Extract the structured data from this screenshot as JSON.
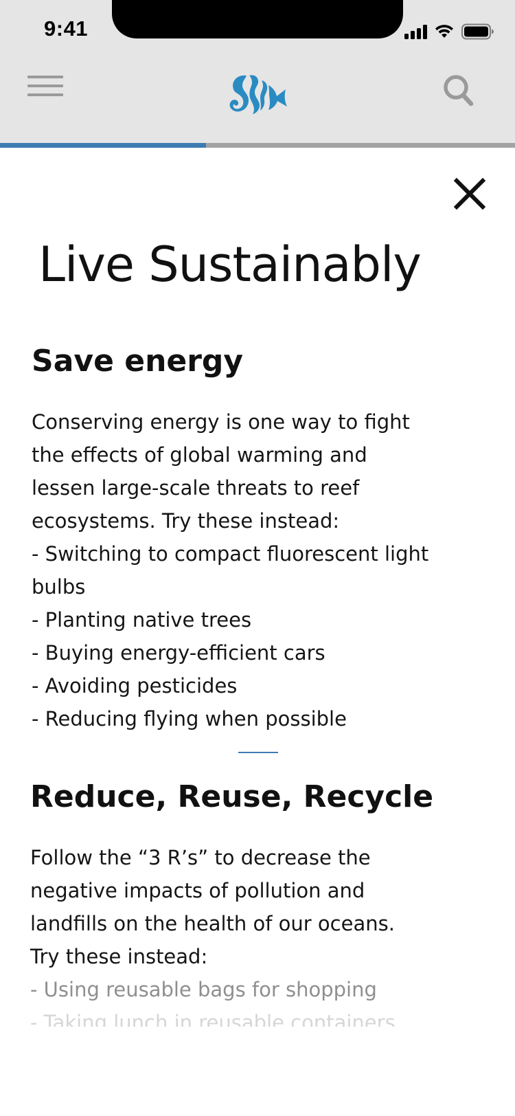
{
  "status_bar": {
    "time": "9:41"
  },
  "header": {
    "progress_fraction": 0.4,
    "accent_color": "#3f7bb3",
    "logo_color": "#2a8bc2"
  },
  "page": {
    "title": "Live Sustainably"
  },
  "sections": [
    {
      "heading": "Save energy",
      "lines": [
        "Conserving energy is one way to fight",
        "the effects of global warming and",
        "lessen large-scale threats to reef",
        "ecosystems. Try these instead:",
        "- Switching to compact fluorescent light",
        "bulbs",
        "- Planting native trees",
        "- Buying energy-efficient cars",
        "- Avoiding pesticides",
        "- Reducing flying when possible"
      ]
    },
    {
      "heading": "Reduce, Reuse, Recycle",
      "lines": [
        "Follow the “3 R’s” to decrease the",
        "negative impacts of pollution and",
        "landfills on the health of our oceans.",
        "Try these instead:",
        "- Using reusable bags for shopping",
        "- Taking lunch in reusable containers"
      ]
    }
  ],
  "icons": [
    "menu-icon",
    "fish-logo-icon",
    "search-icon",
    "close-icon",
    "signal-icon",
    "wifi-icon",
    "battery-icon"
  ]
}
